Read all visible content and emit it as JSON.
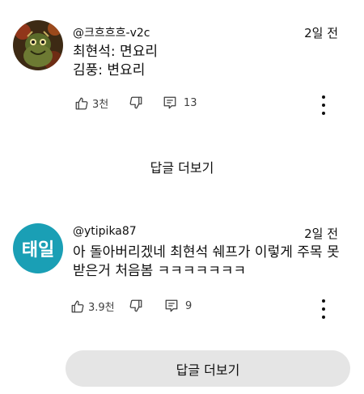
{
  "comments": [
    {
      "author": "@크흐흐흐-v2c",
      "time": "2일 전",
      "lines": [
        "최현석: 면요리",
        "김풍: 변요리"
      ],
      "likes": "3천",
      "replies": "13",
      "avatar_icon": "dark-character-avatar-icon"
    },
    {
      "author": "@ytipika87",
      "time": "2일 전",
      "text": "아 돌아버리겠네 최현석 쉐프가 이렇게 주목 못받은거 처음봄 ㅋㅋㅋㅋㅋㅋㅋ",
      "likes": "3.9천",
      "replies": "9",
      "avatar_text": "태일",
      "avatar_color": "#1a9fb5"
    }
  ],
  "more_replies_label": "답글 더보기",
  "more_replies_button_label": "답글 더보기"
}
